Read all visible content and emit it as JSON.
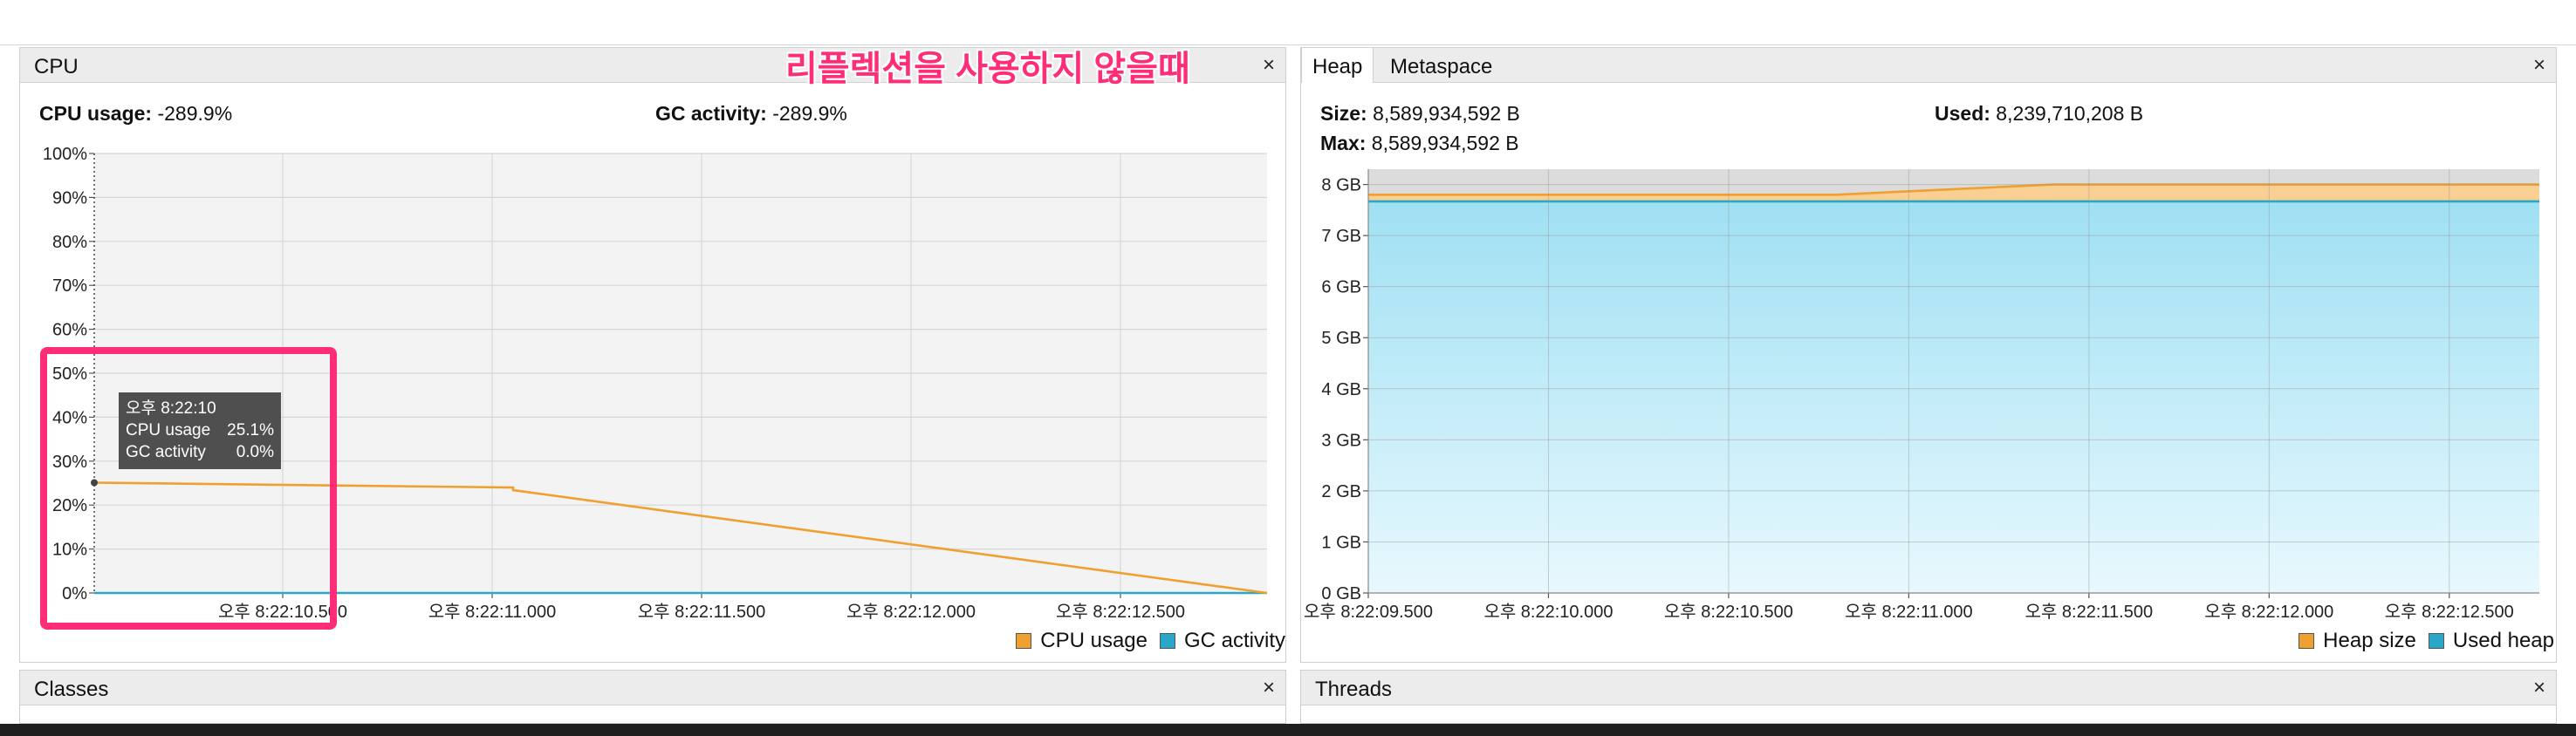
{
  "annotation": "리플렉션을 사용하지 않을때",
  "cpu_panel": {
    "title": "CPU",
    "close": "×",
    "cpu_usage_label": "CPU usage:",
    "cpu_usage_value": "-289.9%",
    "gc_activity_label": "GC activity:",
    "gc_activity_value": "-289.9%",
    "legend": [
      {
        "label": "CPU usage",
        "color": "#f0a030"
      },
      {
        "label": "GC activity",
        "color": "#2aa7c8"
      }
    ],
    "tooltip": {
      "time": "오후 8:22:10",
      "rows": [
        {
          "label": "CPU usage",
          "value": "25.1%"
        },
        {
          "label": "GC activity",
          "value": "0.0%"
        }
      ]
    }
  },
  "heap_panel": {
    "tabs": [
      {
        "label": "Heap",
        "active": true
      },
      {
        "label": "Metaspace",
        "active": false
      }
    ],
    "close": "×",
    "size_label": "Size:",
    "size_value": "8,589,934,592 B",
    "used_label": "Used:",
    "used_value": "8,239,710,208 B",
    "max_label": "Max:",
    "max_value": "8,589,934,592 B",
    "legend": [
      {
        "label": "Heap size",
        "color": "#f0a030"
      },
      {
        "label": "Used heap",
        "color": "#2aa7c8"
      }
    ]
  },
  "classes_panel": {
    "title": "Classes",
    "close": "×"
  },
  "threads_panel": {
    "title": "Threads",
    "close": "×"
  },
  "chart_data": [
    {
      "type": "line",
      "title": "",
      "y_ticks": [
        "0%",
        "10%",
        "20%",
        "30%",
        "40%",
        "50%",
        "60%",
        "70%",
        "80%",
        "90%",
        "100%"
      ],
      "x_ticks": [
        "오후 8:22:10.500",
        "오후 8:22:11.000",
        "오후 8:22:11.500",
        "오후 8:22:12.000",
        "오후 8:22:12.500"
      ],
      "ylim": [
        0,
        100
      ],
      "xlim_sec": [
        10.05,
        12.85
      ],
      "series": [
        {
          "name": "CPU usage",
          "color": "#f0a030",
          "x": [
            10.05,
            11.05,
            11.05,
            12.85
          ],
          "y": [
            25.1,
            24.0,
            23.4,
            0.0
          ]
        },
        {
          "name": "GC activity",
          "color": "#2aa7c8",
          "x": [
            10.05,
            12.85
          ],
          "y": [
            0.0,
            0.0
          ]
        }
      ]
    },
    {
      "type": "area",
      "title": "",
      "y_ticks": [
        "0 GB",
        "1 GB",
        "2 GB",
        "3 GB",
        "4 GB",
        "5 GB",
        "6 GB",
        "7 GB",
        "8 GB"
      ],
      "x_ticks": [
        "오후 8:22:09.500",
        "오후 8:22:10.000",
        "오후 8:22:10.500",
        "오후 8:22:11.000",
        "오후 8:22:11.500",
        "오후 8:22:12.000",
        "오후 8:22:12.500"
      ],
      "ylim": [
        0,
        8.3
      ],
      "xlim_sec": [
        9.5,
        12.75
      ],
      "series": [
        {
          "name": "Heap size",
          "color": "#f0a030",
          "x": [
            9.5,
            10.4,
            10.8,
            11.4,
            12.75
          ],
          "y": [
            7.8,
            7.8,
            7.8,
            8.0,
            8.0
          ]
        },
        {
          "name": "Used heap",
          "color": "#2aa7c8",
          "x": [
            9.5,
            10.4,
            10.8,
            11.4,
            12.75
          ],
          "y": [
            7.67,
            7.67,
            7.67,
            7.67,
            7.67
          ]
        }
      ]
    }
  ]
}
